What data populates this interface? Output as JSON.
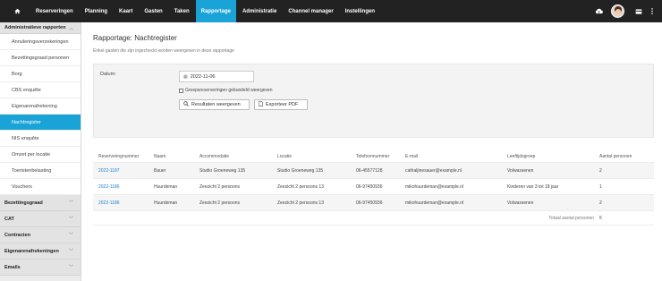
{
  "nav": {
    "home_icon": "home-icon",
    "items": [
      {
        "label": "Reserveringen"
      },
      {
        "label": "Planning"
      },
      {
        "label": "Kaart"
      },
      {
        "label": "Gasten"
      },
      {
        "label": "Taken"
      },
      {
        "label": "Rapportage",
        "active": true
      },
      {
        "label": "Administratie"
      },
      {
        "label": "Channel manager"
      },
      {
        "label": "Instellingen"
      }
    ],
    "right_icons": [
      "cloud-upload-icon",
      "avatar",
      "card-icon",
      "more-vertical-icon"
    ],
    "accent_color": "#1aa3d6"
  },
  "sidebar": {
    "group_open": "Administratieve rapporten",
    "items": [
      "Annuleringsverzekeringen",
      "Bezettingsgraad personen",
      "Borg",
      "CBS enquête",
      "Eigenarenafrekening",
      "Nachtregister",
      "NIS enquête",
      "Omzet per locatie",
      "Toeristenbelasting",
      "Vouchers"
    ],
    "active_index": 5,
    "groups_collapsed": [
      "Bezettingsgraad",
      "CAT",
      "Contracten",
      "Eigenarenafrekeningen",
      "Emails"
    ]
  },
  "main": {
    "title": "Rapportage: Nachtregister",
    "subtitle": "Enkel gasten die zijn ingecheckt worden weergeven in deze rapportage",
    "filter": {
      "date_label": "Datum:",
      "date_value": "2022-11-06",
      "group_checkbox_label": "Groepsreserveringen gebundeld weergeven",
      "group_checked": false,
      "show_button": "Resultaten weergeven",
      "pdf_button": "Exporteer PDF"
    },
    "table": {
      "headers": [
        "Reserveringnummer",
        "Naam",
        "Accommodatie",
        "Locatie",
        "Telefoonnummer",
        "E-mail",
        "Leeftijdsgroep",
        "Aantal personen"
      ],
      "rows": [
        [
          "2022-1187",
          "Bauer",
          "Studio Groeneweg 135",
          "Studio Groeneweg 135",
          "06-45577128",
          "cathaljinesauer@example.nl",
          "Volwassenen",
          "2"
        ],
        [
          "2022-1186",
          "Huurdeman",
          "Zeezicht 2 persoons",
          "Zeezicht 2 persoons 13",
          "06-97450936",
          "mikohuurdeman@example.nl",
          "Kinderen van 3 tot 18 jaar",
          "1"
        ],
        [
          "2022-1186",
          "Huurdeman",
          "Zeezicht 2 persoons",
          "Zeezicht 2 persoons 13",
          "06-97450936",
          "mikohuurdeman@example.nl",
          "Volwassenen",
          "2"
        ]
      ],
      "total_label": "Totaal aantal personen",
      "total_value": "5"
    }
  }
}
